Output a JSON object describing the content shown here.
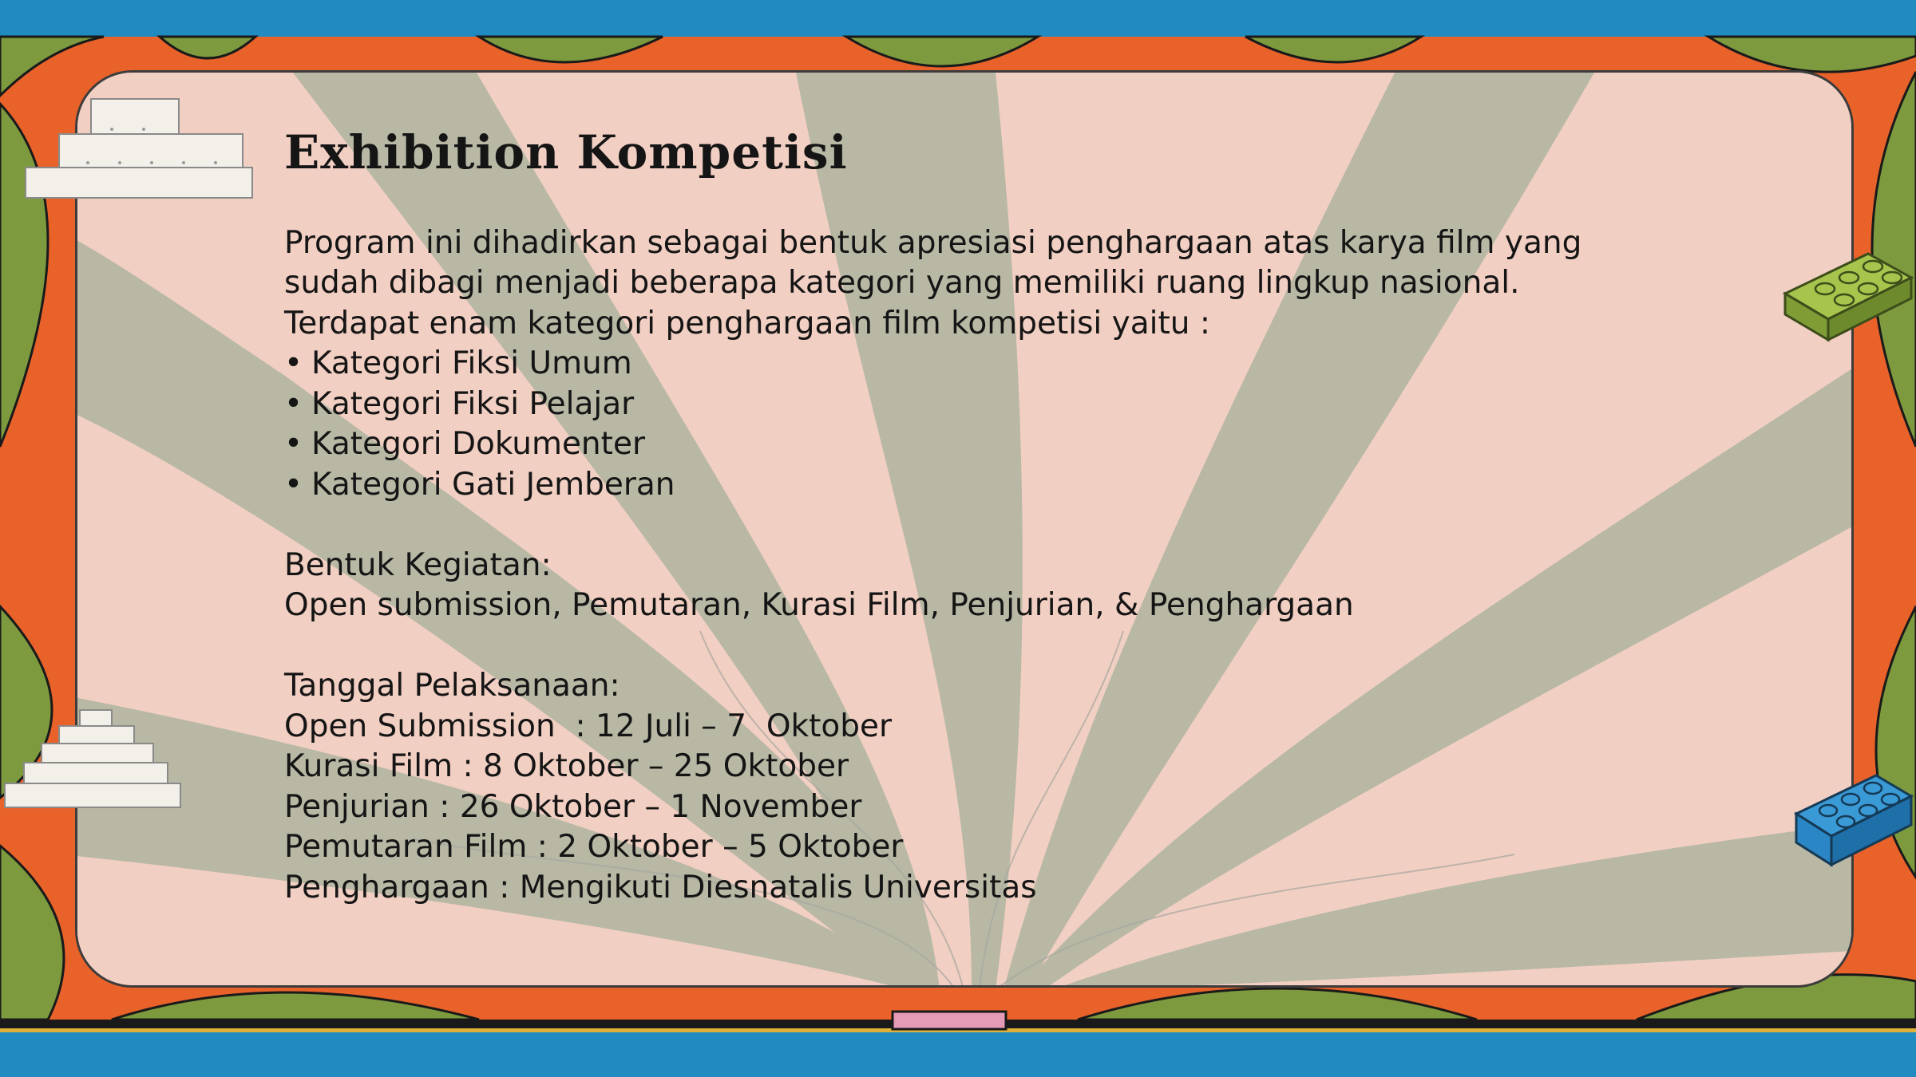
{
  "slide": {
    "title": "Exhibition  Kompetisi",
    "intro_lines": [
      "Program ini dihadirkan sebagai bentuk apresiasi penghargaan atas karya film yang",
      "sudah dibagi menjadi beberapa kategori yang memiliki ruang lingkup nasional.",
      "Terdapat enam kategori penghargaan film kompetisi yaitu :"
    ],
    "bullet": "•",
    "categories": [
      "Kategori Fiksi Umum",
      "Kategori Fiksi Pelajar",
      "Kategori Dokumenter",
      "Kategori Gati Jemberan"
    ],
    "activities_heading": "Bentuk Kegiatan:",
    "activities": "Open submission, Pemutaran, Kurasi Film, Penjurian, & Penghargaan",
    "schedule_heading": "Tanggal Pelaksanaan:",
    "schedule": [
      "Open Submission  : 12 Juli – 7  Oktober",
      "Kurasi Film : 8 Oktober – 25 Oktober",
      "Penjurian : 26 Oktober – 1 November",
      "Pemutaran Film : 2 Oktober – 5 Oktober",
      "Penghargaan : Mengikuti Diesnatalis Universitas"
    ]
  },
  "colors": {
    "top_bar": "#1f8bc1",
    "orange": "#e8622a",
    "green": "#7d9a3e",
    "panel_pink": "#f2cfc3",
    "panel_sage": "#b8b8a5",
    "lego_green": "#8fae3f",
    "lego_blue": "#2b86c5",
    "block_white": "#f3efe9"
  },
  "icons": [
    "lego-brick-green-icon",
    "lego-brick-blue-icon",
    "stepped-pyramid-block-icon"
  ]
}
